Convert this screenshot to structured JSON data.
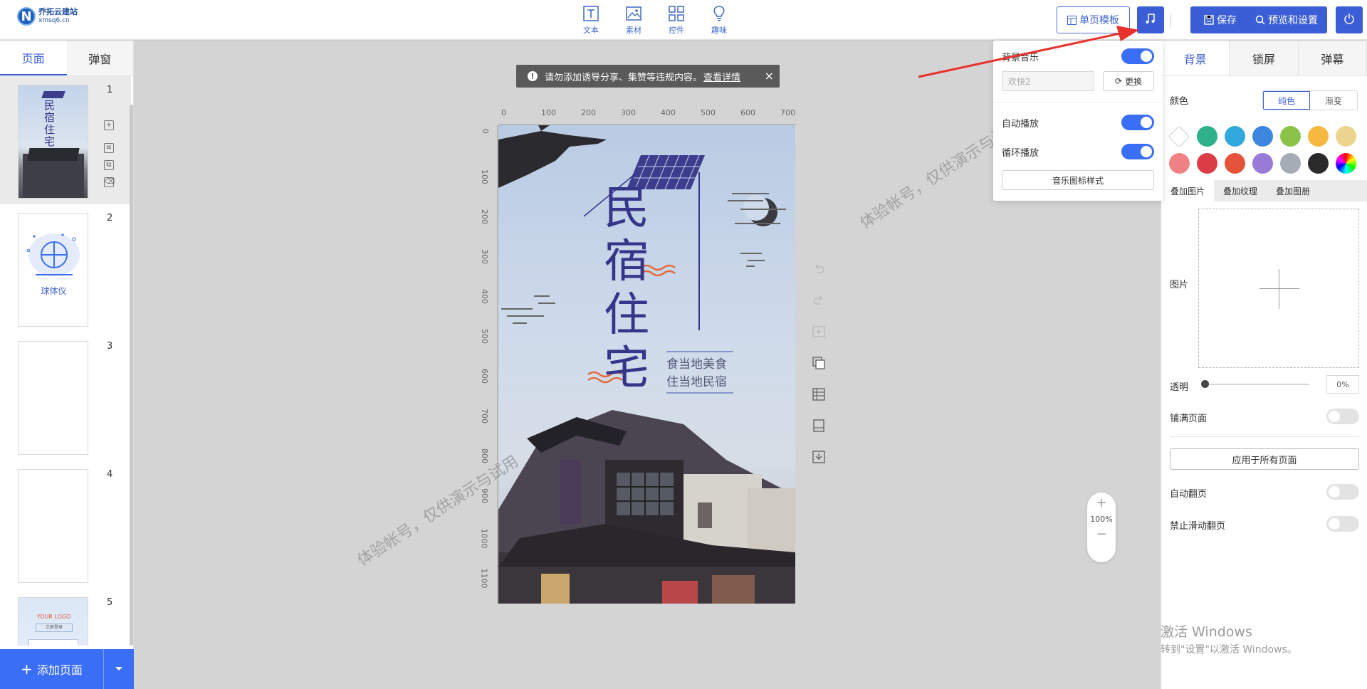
{
  "header": {
    "logo": {
      "name": "乔拓云建站",
      "domain": "xmsq6.cn"
    },
    "tools": [
      {
        "label": "文本",
        "icon": "text-icon"
      },
      {
        "label": "素材",
        "icon": "image-icon"
      },
      {
        "label": "控件",
        "icon": "widgets-icon"
      },
      {
        "label": "趣味",
        "icon": "bulb-icon"
      }
    ],
    "single_template_label": "单页模板",
    "save_label": "保存",
    "preview_label": "预览和设置"
  },
  "left": {
    "tabs": [
      "页面",
      "弹窗"
    ],
    "pages": [
      {
        "num": "1",
        "title": "民宿住宅"
      },
      {
        "num": "2",
        "title": "球体仪"
      },
      {
        "num": "3",
        "title": ""
      },
      {
        "num": "4",
        "title": ""
      },
      {
        "num": "5",
        "title": "YOUR LOGO",
        "sub": "立即登录"
      }
    ],
    "add_page_label": "添加页面"
  },
  "canvas": {
    "notice_text": "请勿添加诱导分享、集赞等违规内容。",
    "notice_link": "查看详情",
    "ruler_h": [
      "0",
      "100",
      "200",
      "300",
      "400",
      "500",
      "600",
      "700"
    ],
    "ruler_v": [
      "0",
      "100",
      "200",
      "300",
      "400",
      "500",
      "600",
      "700",
      "800",
      "900",
      "1000",
      "1100"
    ],
    "poster": {
      "title": [
        "民",
        "宿",
        "住",
        "宅"
      ],
      "line1": "食当地美食",
      "line2": "住当地民宿"
    },
    "zoom": "100%",
    "watermark": "体验帐号，仅供演示与试用"
  },
  "music_popup": {
    "bg_music_label": "背景音乐",
    "bg_music_on": true,
    "track": "欢快2",
    "change_label": "更换",
    "autoplay_label": "自动播放",
    "autoplay_on": true,
    "loop_label": "循环播放",
    "loop_on": true,
    "icon_style_label": "音乐图标样式"
  },
  "right": {
    "tabs": [
      "背景",
      "锁屏",
      "弹幕"
    ],
    "color_label": "颜色",
    "color_modes": [
      "纯色",
      "渐变"
    ],
    "swatches": [
      "#ffffff",
      "#2fb28b",
      "#32a9dc",
      "#3d86e0",
      "#8bc34a",
      "#f5b93f",
      "#ecd38e",
      "#f08285",
      "#db3d47",
      "#e5533a",
      "#9a7ad8",
      "#a5acb5",
      "#2a2a2a",
      "rainbow"
    ],
    "subtabs": [
      "叠加图片",
      "叠加纹理",
      "叠加图册"
    ],
    "image_label": "图片",
    "opacity_label": "透明",
    "opacity_value": "0%",
    "fill_page_label": "铺满页面",
    "apply_all_label": "应用于所有页面",
    "auto_flip_label": "自动翻页",
    "disable_swipe_label": "禁止滑动翻页"
  },
  "windows": {
    "line1": "激活 Windows",
    "line2": "转到\"设置\"以激活 Windows。"
  },
  "colors": {
    "accent": "#3b5ed6",
    "arrow": "#e8322e",
    "poster_title": "#35358a"
  }
}
